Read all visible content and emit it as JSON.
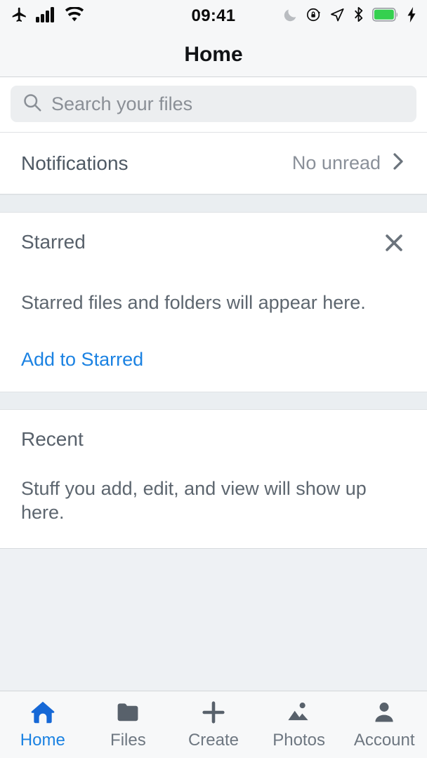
{
  "status_bar": {
    "time": "09:41",
    "left_icons": [
      "airplane-mode-icon",
      "cellular-signal-icon",
      "wifi-icon"
    ],
    "right_icons": [
      "do-not-disturb-moon-icon",
      "rotation-lock-icon",
      "location-arrow-icon",
      "bluetooth-icon",
      "battery-icon",
      "charging-bolt-icon"
    ],
    "battery_color": "#35d04f"
  },
  "navbar": {
    "title": "Home"
  },
  "search": {
    "placeholder": "Search your files",
    "value": ""
  },
  "notifications": {
    "label": "Notifications",
    "value": "No unread",
    "chevron": "chevron-right-icon"
  },
  "starred": {
    "title": "Starred",
    "empty_text": "Starred files and folders will appear here.",
    "action_label": "Add to Starred",
    "close_icon": "close-x-icon"
  },
  "recent": {
    "title": "Recent",
    "empty_text": "Stuff you add, edit, and view will show up here."
  },
  "tabbar": {
    "items": [
      {
        "label": "Home",
        "icon": "home-icon",
        "active": true
      },
      {
        "label": "Files",
        "icon": "folder-icon",
        "active": false
      },
      {
        "label": "Create",
        "icon": "plus-icon",
        "active": false
      },
      {
        "label": "Photos",
        "icon": "image-icon",
        "active": false
      },
      {
        "label": "Account",
        "icon": "person-icon",
        "active": false
      }
    ]
  },
  "colors": {
    "accent": "#1b82e2",
    "icon_gray": "#58616b",
    "text_gray": "#5d666f",
    "bg": "#eef1f4"
  }
}
